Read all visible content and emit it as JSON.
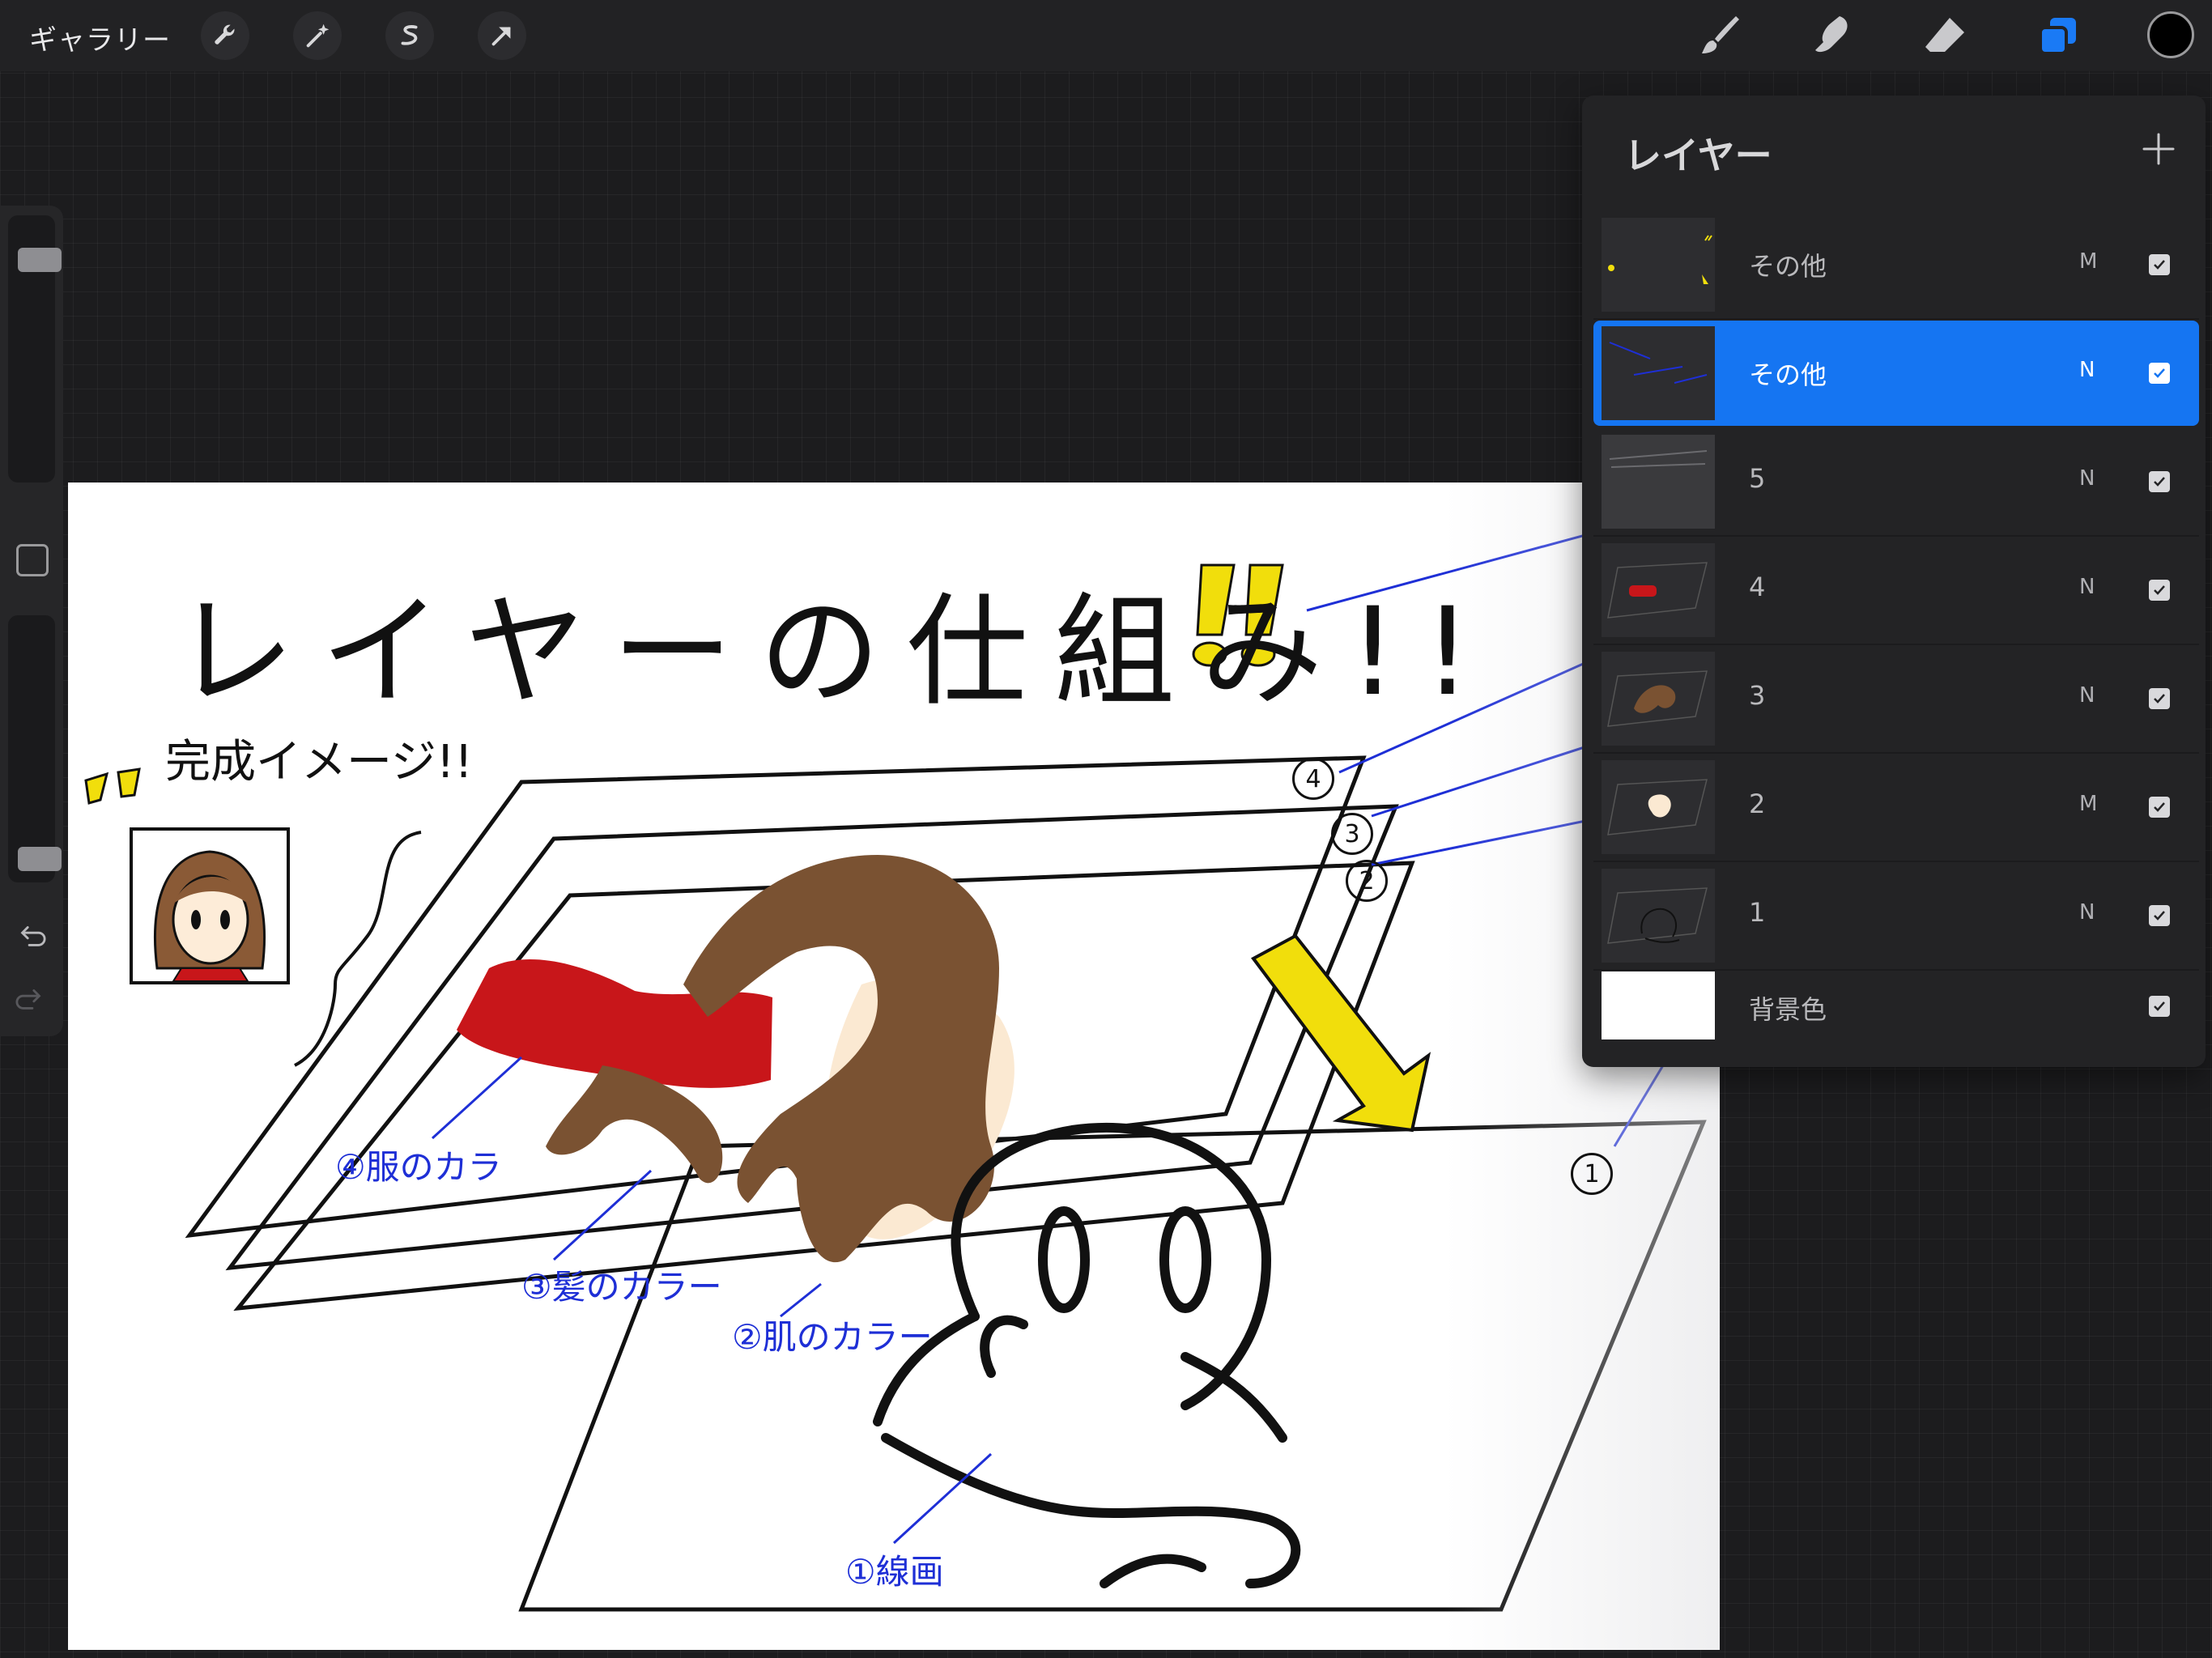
{
  "topbar": {
    "gallery_label": "ギャラリー",
    "left_tools": [
      "wrench-icon",
      "magic-wand-icon",
      "selection-icon",
      "transform-arrow-icon"
    ],
    "right_tools": [
      "brush-icon",
      "smudge-icon",
      "eraser-icon",
      "layers-icon"
    ],
    "layers_accent": "#1a7af5",
    "current_color": "#000000"
  },
  "sidebar": {
    "brush_size_level": 0.13,
    "opacity_level": 0.96,
    "undo_icon": "undo-icon",
    "redo_icon": "redo-icon"
  },
  "canvas": {
    "title": "レイヤーの仕組み!!",
    "complete_label": "完成イメージ!!",
    "annotations": {
      "clothes": "④服のカラ",
      "hair": "③髪のカラー",
      "skin": "②肌のカラー",
      "line": "①線画",
      "plane_4": "4",
      "plane_3": "3",
      "plane_2": "2",
      "plane_1": "1"
    },
    "colors": {
      "annotation_blue": "#1e2fd6",
      "clothes_red": "#c8161a",
      "hair_brown": "#7a5232",
      "skin_peach": "#fbe9d2",
      "highlight_yellow": "#f1de0c"
    }
  },
  "layers_panel": {
    "title": "レイヤー",
    "add_label": "+",
    "layers": [
      {
        "name": "その他",
        "blend": "M",
        "visible": true,
        "active": false
      },
      {
        "name": "その他",
        "blend": "N",
        "visible": true,
        "active": true
      },
      {
        "name": "5",
        "blend": "N",
        "visible": true,
        "active": false
      },
      {
        "name": "4",
        "blend": "N",
        "visible": true,
        "active": false
      },
      {
        "name": "3",
        "blend": "N",
        "visible": true,
        "active": false
      },
      {
        "name": "2",
        "blend": "M",
        "visible": true,
        "active": false
      },
      {
        "name": "1",
        "blend": "N",
        "visible": true,
        "active": false
      },
      {
        "name": "背景色",
        "blend": "",
        "visible": true,
        "active": false
      }
    ]
  }
}
